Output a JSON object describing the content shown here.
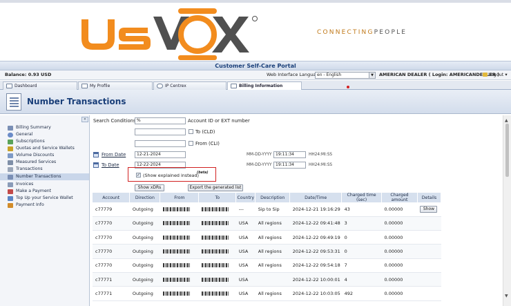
{
  "brand": {
    "logo_text": "UsVoX",
    "tagline_part1": "CONNECTING",
    "tagline_part2": "PEOPLE",
    "accent_orange": "#f28c1e",
    "logo_gray": "#505050"
  },
  "portal_title": "Customer Self-Care Portal",
  "toolbar": {
    "balance": "Balance: 0.93 USD",
    "language_label": "Web Interface Language",
    "language_value": "en - English",
    "user_info": "AMERICAN DEALER ( Login: AMERICANDEALER )",
    "logout_label": "Logout"
  },
  "tabs": [
    {
      "label": "Dashboard",
      "icon": "dashboard-icon",
      "active": false
    },
    {
      "label": "My Profile",
      "icon": "user-icon",
      "active": false
    },
    {
      "label": "IP Centrex",
      "icon": "pbx-icon",
      "active": false
    },
    {
      "label": "Billing Information",
      "icon": "billing-icon",
      "active": true
    }
  ],
  "page_title": "Number Transactions",
  "sidebar": {
    "collapse_label": "«",
    "items": [
      {
        "label": "Billing Summary",
        "icon": "summary-icon",
        "color": "#7a8fb5"
      },
      {
        "label": "General",
        "icon": "general-icon",
        "color": "#6b8cc8"
      },
      {
        "label": "Subscriptions",
        "icon": "subscriptions-icon",
        "color": "#5aa35a"
      },
      {
        "label": "Quotas and Service Wallets",
        "icon": "quotas-icon",
        "color": "#c9a227"
      },
      {
        "label": "Volume Discounts",
        "icon": "discounts-icon",
        "color": "#7e9ac6"
      },
      {
        "label": "Measured Services",
        "icon": "measured-icon",
        "color": "#7f8fa8"
      },
      {
        "label": "Transactions",
        "icon": "transactions-icon",
        "color": "#9aa6b8"
      },
      {
        "label": "Number Transactions",
        "icon": "number-transactions-icon",
        "color": "#7a8fb5",
        "active": true
      },
      {
        "label": "Invoices",
        "icon": "invoices-icon",
        "color": "#8a9bb8"
      },
      {
        "label": "Make a Payment",
        "icon": "payment-icon",
        "color": "#c24a4a"
      },
      {
        "label": "Top Up your Service Wallet",
        "icon": "wallet-icon",
        "color": "#5b86c6"
      },
      {
        "label": "Payment Info",
        "icon": "payment-info-icon",
        "color": "#d28c2a"
      }
    ]
  },
  "form": {
    "search_label": "Search Conditions",
    "search_value": "%",
    "account_hint": "Account ID or EXT number",
    "to_label": "To (CLD)",
    "from_label": "From (CLI)",
    "from_date_label": "From Date",
    "from_date_value": "12-21-2024",
    "to_date_label": "To Date",
    "to_date_value": "12-22-2024",
    "date_format": "MM-DD-YYYY",
    "from_time_value": "19:11:34",
    "to_time_value": "19:11:34",
    "time_format": "HH24:MI:SS",
    "show_explained_label": "(Show explained instead)",
    "beta_label": "(beta)",
    "show_xdrs_label": "Show xDRs",
    "export_label": "Export the generated list"
  },
  "table": {
    "columns": [
      "Account",
      "Direction",
      "From",
      "To",
      "Country",
      "Description",
      "Date/Time",
      "Charged time (sec)",
      "Charged amount",
      "Details"
    ],
    "rows": [
      {
        "account": "c77779",
        "direction": "Outgoing",
        "country": "---",
        "description": "Sip to Sip",
        "datetime": "2024-12-21 19:16:29",
        "charged_time": "43",
        "charged_amount": "0.00000",
        "details": "Show"
      },
      {
        "account": "c77770",
        "direction": "Outgoing",
        "country": "USA",
        "description": "All regions",
        "datetime": "2024-12-22 09:41:48",
        "charged_time": "3",
        "charged_amount": "0.00000",
        "details": ""
      },
      {
        "account": "c77770",
        "direction": "Outgoing",
        "country": "USA",
        "description": "All regions",
        "datetime": "2024-12-22 09:49:19",
        "charged_time": "0",
        "charged_amount": "0.00000",
        "details": ""
      },
      {
        "account": "c77770",
        "direction": "Outgoing",
        "country": "USA",
        "description": "All regions",
        "datetime": "2024-12-22 09:53:31",
        "charged_time": "0",
        "charged_amount": "0.00000",
        "details": ""
      },
      {
        "account": "c77770",
        "direction": "Outgoing",
        "country": "USA",
        "description": "All regions",
        "datetime": "2024-12-22 09:54:18",
        "charged_time": "7",
        "charged_amount": "0.00000",
        "details": ""
      },
      {
        "account": "c77771",
        "direction": "Outgoing",
        "country": "USA",
        "description": "",
        "datetime": "2024-12-22 10:00:01",
        "charged_time": "4",
        "charged_amount": "0.00000",
        "details": ""
      },
      {
        "account": "c77771",
        "direction": "Outgoing",
        "country": "USA",
        "description": "All regions",
        "datetime": "2024-12-22 10:03:05",
        "charged_time": "492",
        "charged_amount": "0.00000",
        "details": ""
      }
    ]
  }
}
